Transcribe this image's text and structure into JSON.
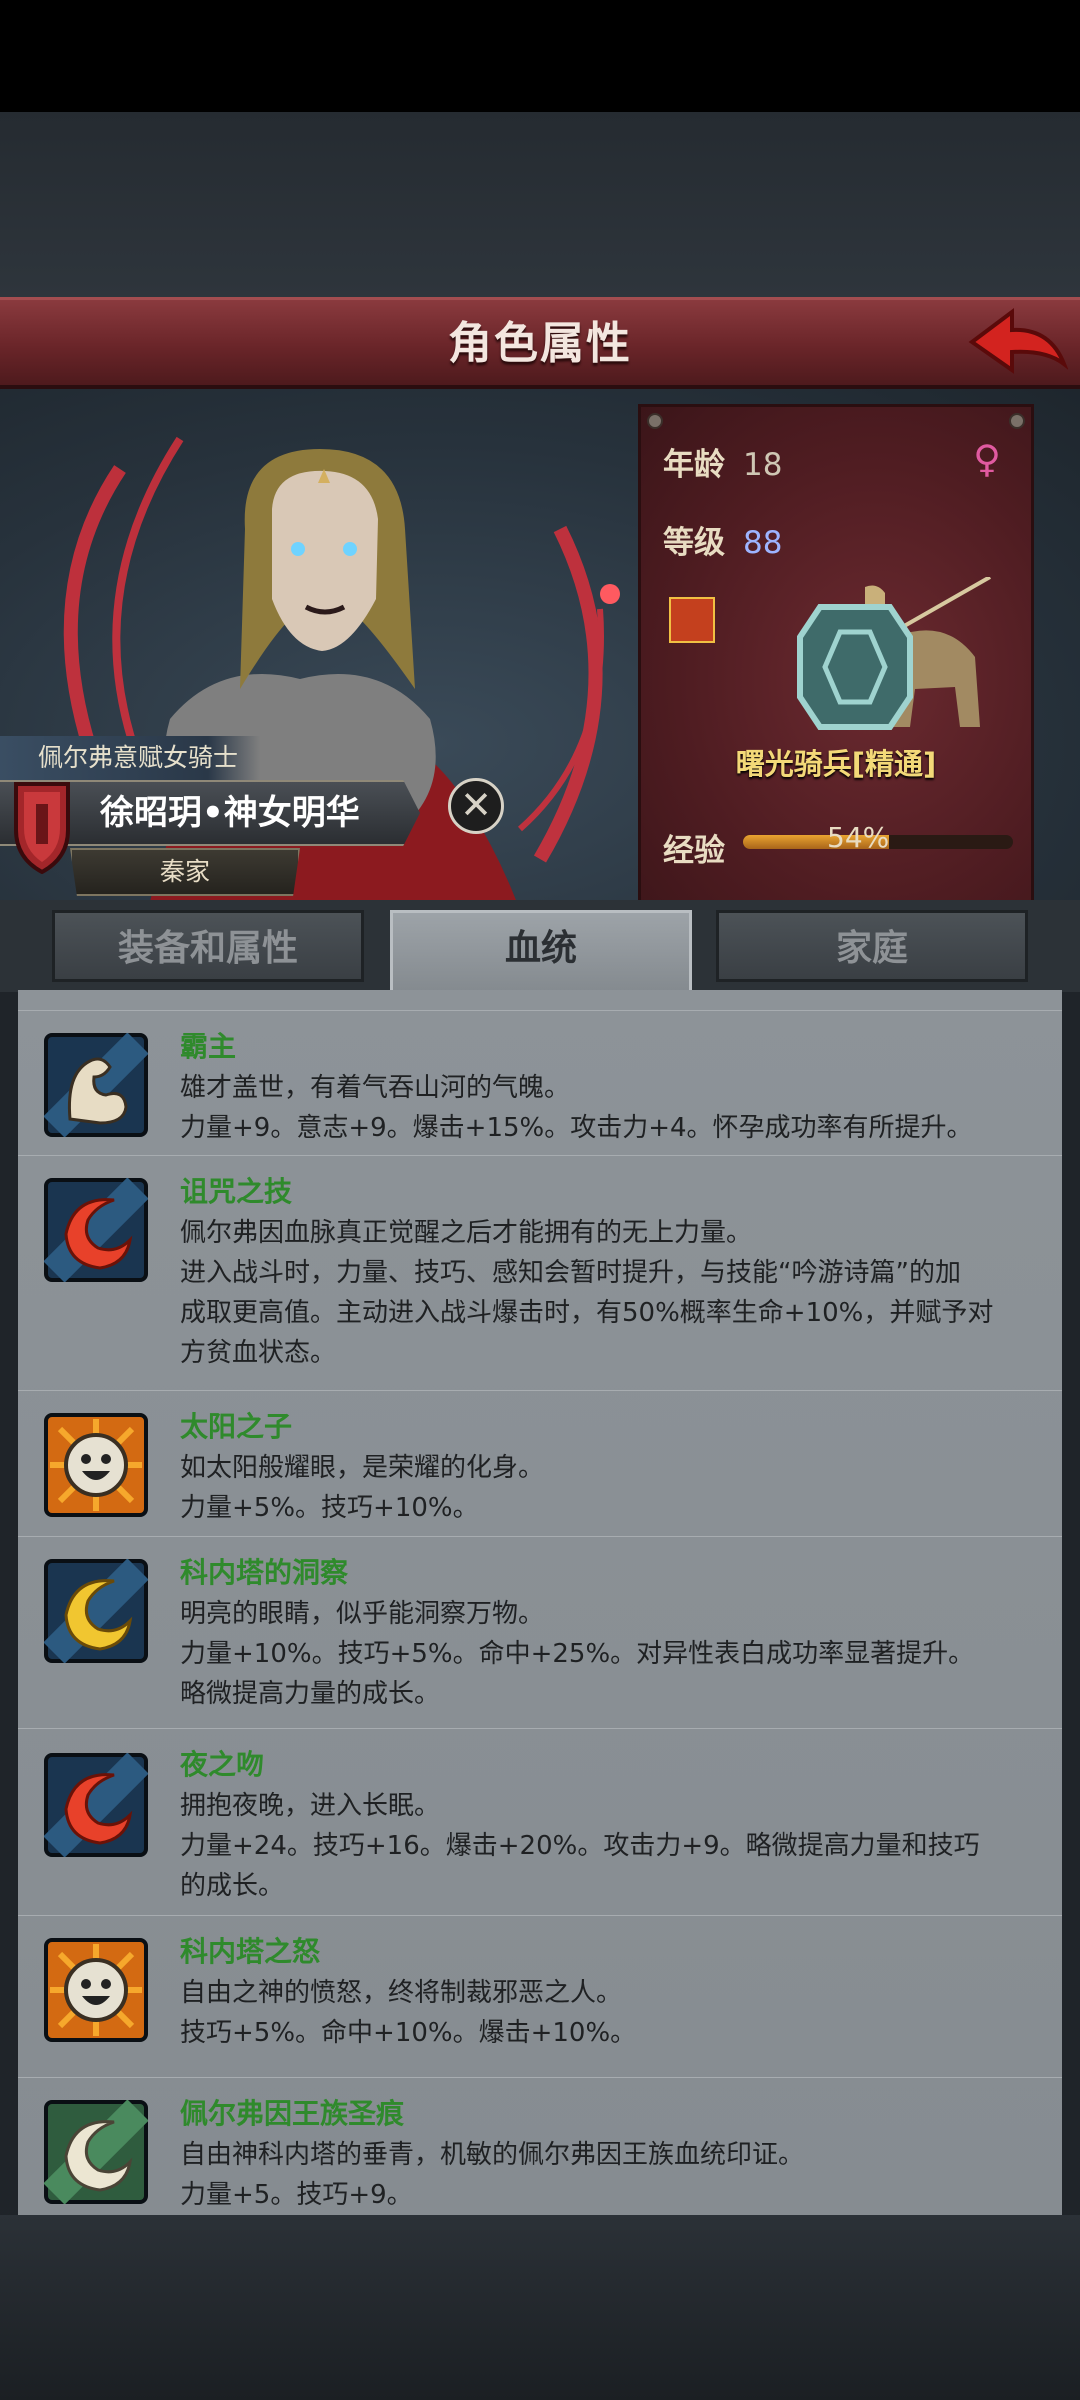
{
  "header": {
    "title": "角色属性"
  },
  "character": {
    "subtitle": "佩尔弗意赋女骑士",
    "name": "徐昭玥•神女明华",
    "family": "秦家"
  },
  "stats": {
    "age_label": "年龄",
    "age": "18",
    "level_label": "等级",
    "level": "88",
    "class_name": "曙光骑兵[精通]",
    "exp_label": "经验",
    "exp_percent": "54%",
    "exp_fraction": 0.54
  },
  "tabs": [
    {
      "label": "装备和属性",
      "active": false
    },
    {
      "label": "血统",
      "active": true
    },
    {
      "label": "家庭",
      "active": false
    }
  ],
  "traits": [
    {
      "name": "霸主",
      "icon": "flexing-arm-icon",
      "lines": [
        "雄才盖世，有着气吞山河的气魄。",
        "力量+9。意志+9。爆击+15%。攻击力+4。怀孕成功率有所提升。"
      ]
    },
    {
      "name": "诅咒之技",
      "icon": "red-crescent-icon",
      "lines": [
        "佩尔弗因血脉真正觉醒之后才能拥有的无上力量。",
        "进入战斗时，力量、技巧、感知会暂时提升，与技能“吟游诗篇”的加",
        "成取更高值。主动进入战斗爆击时，有50%概率生命+10%，并赋予对",
        "方贫血状态。"
      ]
    },
    {
      "name": "太阳之子",
      "icon": "sun-face-icon",
      "lines": [
        "如太阳般耀眼，是荣耀的化身。",
        "力量+5%。技巧+10%。"
      ]
    },
    {
      "name": "科内塔的洞察",
      "icon": "gold-crescent-icon",
      "lines": [
        "明亮的眼睛，似乎能洞察万物。",
        "力量+10%。技巧+5%。命中+25%。对异性表白成功率显著提升。",
        "略微提高力量的成长。"
      ]
    },
    {
      "name": "夜之吻",
      "icon": "red-crescent-icon",
      "lines": [
        "拥抱夜晚，进入长眠。",
        "力量+24。技巧+16。爆击+20%。攻击力+9。略微提高力量和技巧",
        "的成长。"
      ]
    },
    {
      "name": "科内塔之怒",
      "icon": "sun-face-icon",
      "lines": [
        "自由之神的愤怒，终将制裁邪恶之人。",
        "技巧+5%。命中+10%。爆击+10%。"
      ]
    },
    {
      "name": "佩尔弗因王族圣痕",
      "icon": "white-crescent-icon",
      "lines": [
        "自由神科内塔的垂青，机敏的佩尔弗因王族血统印证。",
        "力量+5。技巧+9。"
      ]
    }
  ]
}
